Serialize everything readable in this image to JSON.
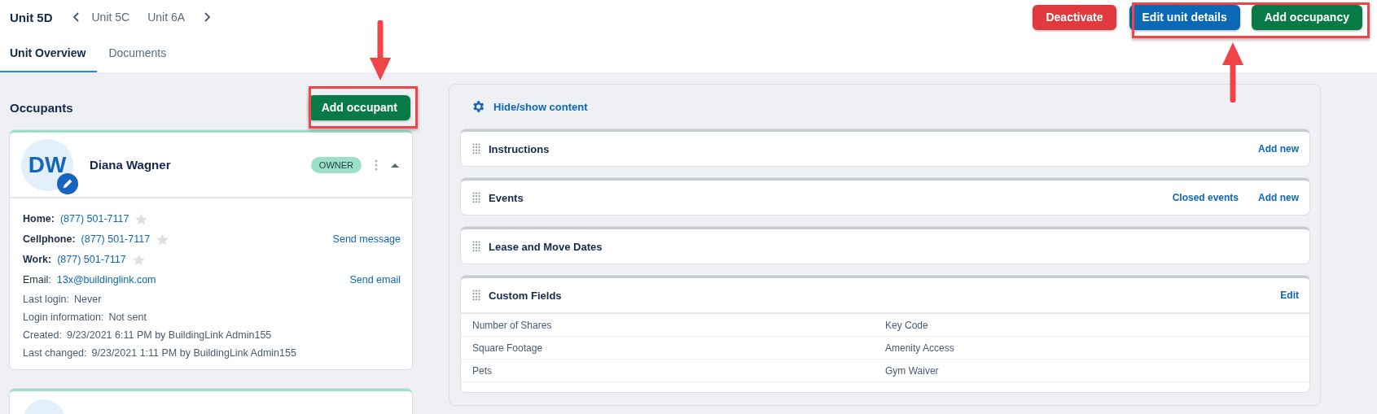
{
  "header": {
    "title": "Unit 5D",
    "prev_unit": "Unit 5C",
    "next_unit": "Unit 6A",
    "actions": [
      {
        "label": "Deactivate",
        "kind": "danger"
      },
      {
        "label": "Edit unit details",
        "kind": "primary"
      },
      {
        "label": "Add occupancy",
        "kind": "success"
      }
    ]
  },
  "tabs": [
    {
      "label": "Unit Overview",
      "selected": true
    },
    {
      "label": "Documents",
      "selected": false
    }
  ],
  "occupants": {
    "heading": "Occupants",
    "add_button": "Add occupant",
    "cards": [
      {
        "initials": "DW",
        "name": "Diana Wagner",
        "badge": "OWNER",
        "expanded": true,
        "phones": [
          {
            "label": "Home:",
            "number": "(877) 501-7117",
            "starred": false
          },
          {
            "label": "Cellphone:",
            "number": "(877) 501-7117",
            "starred": false,
            "action": "Send message"
          },
          {
            "label": "Work:",
            "number": "(877) 501-7117",
            "starred": false
          }
        ],
        "email": {
          "label": "Email:",
          "value": "13x@buildinglink.com",
          "action": "Send email"
        },
        "info": [
          {
            "label": "Last login:",
            "value": "Never"
          },
          {
            "label": "Login information:",
            "value": "Not sent"
          },
          {
            "label": "Created:",
            "value": "9/23/2021 6:11 PM by BuildingLink Admin155"
          },
          {
            "label": "Last changed:",
            "value": "9/23/2021 1:11 PM by BuildingLink Admin155"
          }
        ]
      }
    ]
  },
  "content": {
    "toggle": "Hide/show content",
    "sections": [
      {
        "title": "Instructions",
        "links": [
          "Add new"
        ]
      },
      {
        "title": "Events",
        "links": [
          "Closed events",
          "Add new"
        ]
      },
      {
        "title": "Lease and Move Dates"
      },
      {
        "title": "Custom Fields",
        "links": [
          "Edit"
        ],
        "fields": [
          [
            "Number of Shares",
            "Key Code"
          ],
          [
            "Square Footage",
            "Amenity Access"
          ],
          [
            "Pets",
            "Gym Waiver"
          ]
        ]
      }
    ]
  }
}
